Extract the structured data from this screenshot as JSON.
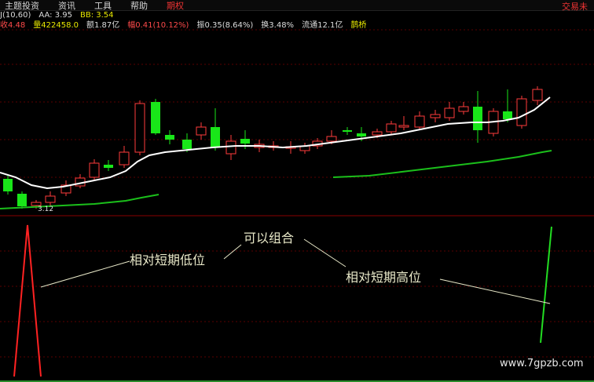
{
  "menu": {
    "items": [
      "主题投资",
      "资讯",
      "工具",
      "帮助",
      "期权"
    ],
    "active_index": 4,
    "right": "交易未"
  },
  "info": {
    "ma_label": "J(10,60)",
    "aa": "AA: 3.95",
    "bb": "BB: 3.54",
    "close": "收4.48",
    "volume": "量422458.0",
    "amount": "额1.87亿",
    "change": "幅0.41(10.12%)",
    "amplitude": "振0.35(8.64%)",
    "turnover": "换3.48%",
    "float": "流通12.1亿",
    "link": "鹊桥"
  },
  "chart": {
    "low_price_label": "3.12"
  },
  "annotations": {
    "low": "相对短期低位",
    "combine": "可以组合",
    "high": "相对短期高位"
  },
  "watermark": "www.7gpzb.com",
  "colors": {
    "up": "#ff3b3b",
    "down": "#19e619",
    "ma": "#ffffff",
    "ma_long": "#1bbf1b",
    "indicator_red": "#ff2222",
    "indicator_green": "#22dd22"
  }
}
